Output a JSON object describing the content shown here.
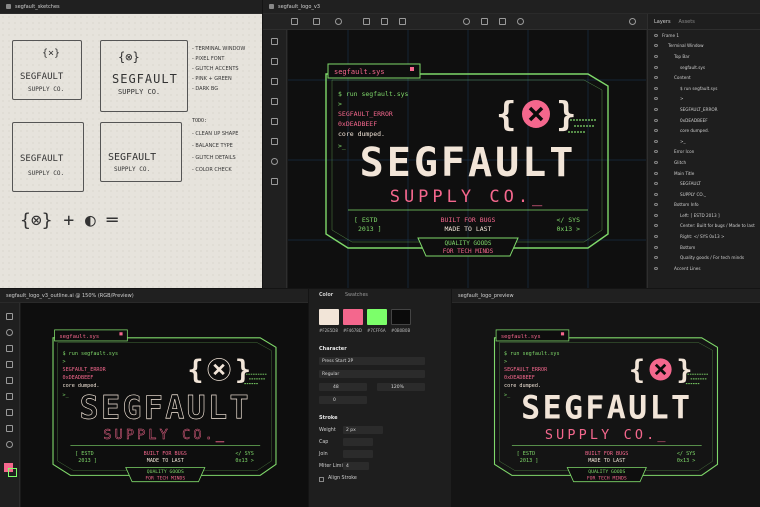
{
  "colors": {
    "cream": "#F2E5D8",
    "pink": "#F4678D",
    "green": "#7CFF6A",
    "dark": "#0B0B0B",
    "accent": "#7FD86A"
  },
  "sketch": {
    "tab": "segfault_sketches",
    "notes": [
      "TERMINAL WINDOW",
      "PIXEL FONT",
      "GLITCH ACCENTS",
      "PINK + GREEN",
      "DARK BG"
    ],
    "todo_title": "TODO:",
    "todo": [
      "CLEAN UP SHAPE",
      "BALANCE TYPE",
      "GLITCH DETAILS",
      "COLOR CHECK"
    ],
    "brand": "SEGFAULT",
    "sub": "SUPPLY CO.",
    "small": "SEGFAULT",
    "small_sub": "SUPPLY CO."
  },
  "editor": {
    "tab": "segfault_logo_v3",
    "layers_tab": "Layers",
    "assets_tab": "Assets",
    "layers": [
      {
        "label": "Frame 1",
        "depth": 0
      },
      {
        "label": "Terminal Window",
        "depth": 1
      },
      {
        "label": "Top Bar",
        "depth": 2
      },
      {
        "label": "segfault.sys",
        "depth": 3
      },
      {
        "label": "Content",
        "depth": 2
      },
      {
        "label": "$ run segfault.sys",
        "depth": 3
      },
      {
        "label": ">",
        "depth": 3
      },
      {
        "label": "SEGFAULT_ERROR",
        "depth": 3
      },
      {
        "label": "0xDEADBEEF",
        "depth": 3
      },
      {
        "label": "core dumped.",
        "depth": 3
      },
      {
        "label": ">_",
        "depth": 3
      },
      {
        "label": "Error Icon",
        "depth": 2
      },
      {
        "label": "Glitch",
        "depth": 2
      },
      {
        "label": "Main Title",
        "depth": 2
      },
      {
        "label": "SEGFAULT",
        "depth": 3
      },
      {
        "label": "SUPPLY CO._",
        "depth": 3
      },
      {
        "label": "Bottom Info",
        "depth": 2
      },
      {
        "label": "Left: [ ESTD 2013 ]",
        "depth": 3
      },
      {
        "label": "Center: Built for bugs / Made to last",
        "depth": 3
      },
      {
        "label": "Right: </ SYS 0x13 >",
        "depth": 3
      },
      {
        "label": "Bottom",
        "depth": 3
      },
      {
        "label": "Quality goods / For tech minds",
        "depth": 3
      },
      {
        "label": "Accent Lines",
        "depth": 2
      }
    ]
  },
  "outline": {
    "tab": "segfault_logo_v3_outline.ai @ 150% (RGB/Preview)"
  },
  "props": {
    "tab_color": "Color",
    "tab_swatches": "Swatches",
    "swatches": [
      {
        "hex": "#F2E5D8"
      },
      {
        "hex": "#F4678D"
      },
      {
        "hex": "#7CFF6A"
      },
      {
        "hex": "#0B0B0B"
      }
    ],
    "swatch_labels": [
      "#F2E5D8",
      "#F4678D",
      "#7CFF6A",
      "#0B0B0B"
    ],
    "character": "Character",
    "font": "Press Start 2P",
    "style": "Regular",
    "size": "48",
    "tracking": "120%",
    "leading": "0",
    "stroke": "Stroke",
    "weight_label": "Weight",
    "weight": "2 px",
    "cap_label": "Cap",
    "join_label": "Join",
    "miter_label": "Miter Limit",
    "miter": "4",
    "align_stroke": "Align Stroke"
  },
  "preview": {
    "tab": "segfault_logo_preview"
  },
  "logo": {
    "window_title": "segfault.sys",
    "cmd": "$ run segfault.sys",
    "prompt": ">",
    "err": "SEGFAULT_ERROR",
    "addr": "0xDEADBEEF",
    "dump": "core dumped.",
    "cursor": ">_",
    "brand": "SEGFAULT",
    "tagline": "SUPPLY CO._",
    "left1": "[ ESTD",
    "left2": "2013 ]",
    "center1": "BUILT FOR BUGS",
    "center2": "MADE TO LAST",
    "right1": "</ SYS",
    "right2": "0x13 >",
    "bottom1": "QUALITY GOODS",
    "bottom2": "FOR TECH MINDS"
  }
}
